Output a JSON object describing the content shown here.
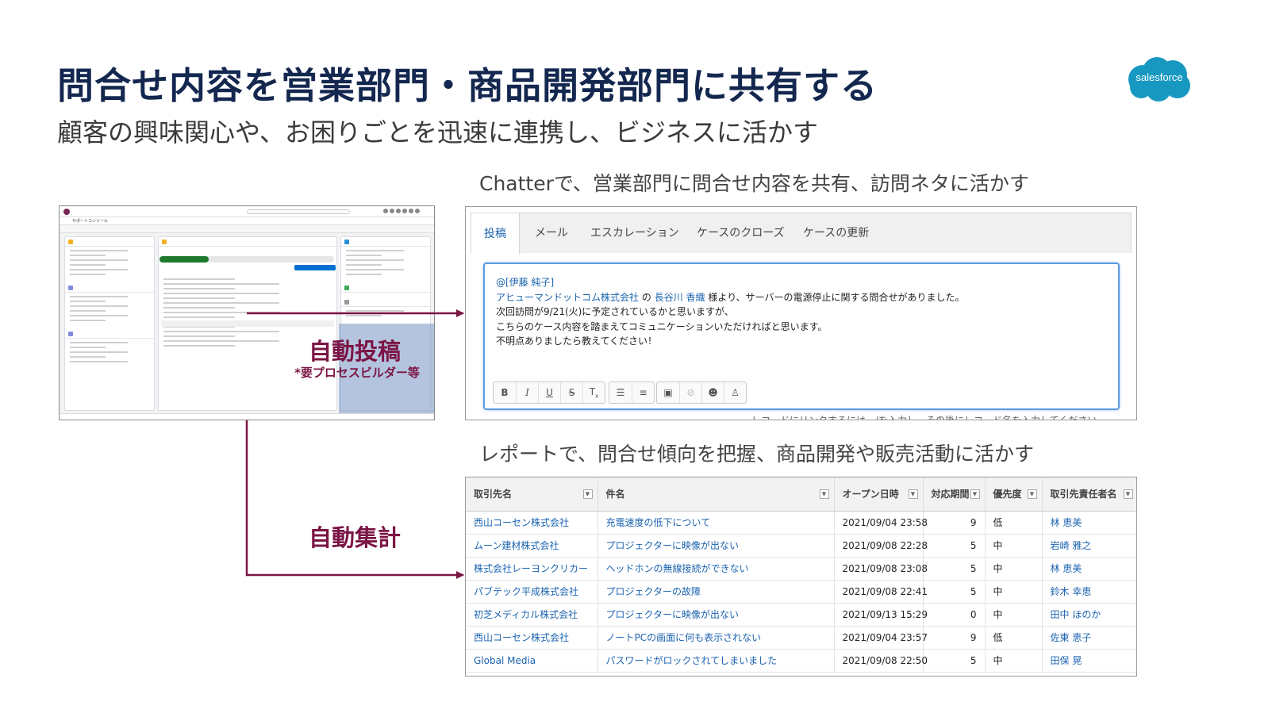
{
  "slide": {
    "title": "問合せ内容を営業部門・商品開発部門に共有する",
    "subtitle": "顧客の興味関心や、お困りごとを迅速に連携し、ビジネスに活かす"
  },
  "logo": {
    "text": "salesforce",
    "color": "#1798c1"
  },
  "colors": {
    "title": "#13274f",
    "accent": "#7b1545",
    "link": "#1b63b0"
  },
  "labels": {
    "chatter": "Chatterで、営業部門に問合せ内容を共有、訪問ネタに活かす",
    "report": "レポートで、問合せ傾向を把握、商品開発や販売活動に活かす",
    "auto_post": "自動投稿",
    "auto_post_note": "*要プロセスビルダー等",
    "auto_aggregate": "自動集計"
  },
  "console": {
    "app_name": "サポートコンソール"
  },
  "chatter": {
    "tabs": [
      "投稿",
      "メール",
      "エスカレーション",
      "ケースのクローズ",
      "ケースの更新"
    ],
    "active_tab": "投稿",
    "post": {
      "mention": "@[伊藤 純子]",
      "company": "アヒューマンドットコム株式会社",
      "particle": "の",
      "contact": "長谷川 香織",
      "line1_rest": "様より、サーバーの電源停止に関する問合せがありました。",
      "line2": "次回訪問が9/21(火)に予定されているかと思いますが、",
      "line3": "こちらのケース内容を踏まえてコミュニケーションいただければと思います。",
      "line4": "不明点ありましたら教えてください！"
    },
    "toolbar": [
      "bold-icon",
      "italic-icon",
      "underline-icon",
      "strikethrough-icon",
      "clear-format-icon",
      "bullet-list-icon",
      "numbered-list-icon",
      "image-icon",
      "link-icon",
      "emoji-icon",
      "mention-icon"
    ],
    "cut_text": "レコードにリンクするには、/を入力し、その後にレコード名を入力してください"
  },
  "report": {
    "columns": [
      "取引先名",
      "件名",
      "オープン日時",
      "対応期間",
      "優先度",
      "取引先責任者名"
    ],
    "rows": [
      [
        "西山コーセン株式会社",
        "充電速度の低下について",
        "2021/09/04 23:58",
        "9",
        "低",
        "林 恵美"
      ],
      [
        "ムーン建材株式会社",
        "プロジェクターに映像が出ない",
        "2021/09/08 22:28",
        "5",
        "中",
        "岩崎 雅之"
      ],
      [
        "株式会社レーヨンクリカー",
        "ヘッドホンの無線接続ができない",
        "2021/09/08 23:08",
        "5",
        "中",
        "林 恵美"
      ],
      [
        "パブテック平成株式会社",
        "プロジェクターの故障",
        "2021/09/08 22:41",
        "5",
        "中",
        "鈴木 幸恵"
      ],
      [
        "初芝メディカル株式会社",
        "プロジェクターに映像が出ない",
        "2021/09/13 15:29",
        "0",
        "中",
        "田中 ほのか"
      ],
      [
        "西山コーセン株式会社",
        "ノートPCの画面に何も表示されない",
        "2021/09/04 23:57",
        "9",
        "低",
        "佐東 恵子"
      ],
      [
        "Global Media",
        "パスワードがロックされてしまいました",
        "2021/09/08 22:50",
        "5",
        "中",
        "田保 晃"
      ]
    ]
  }
}
